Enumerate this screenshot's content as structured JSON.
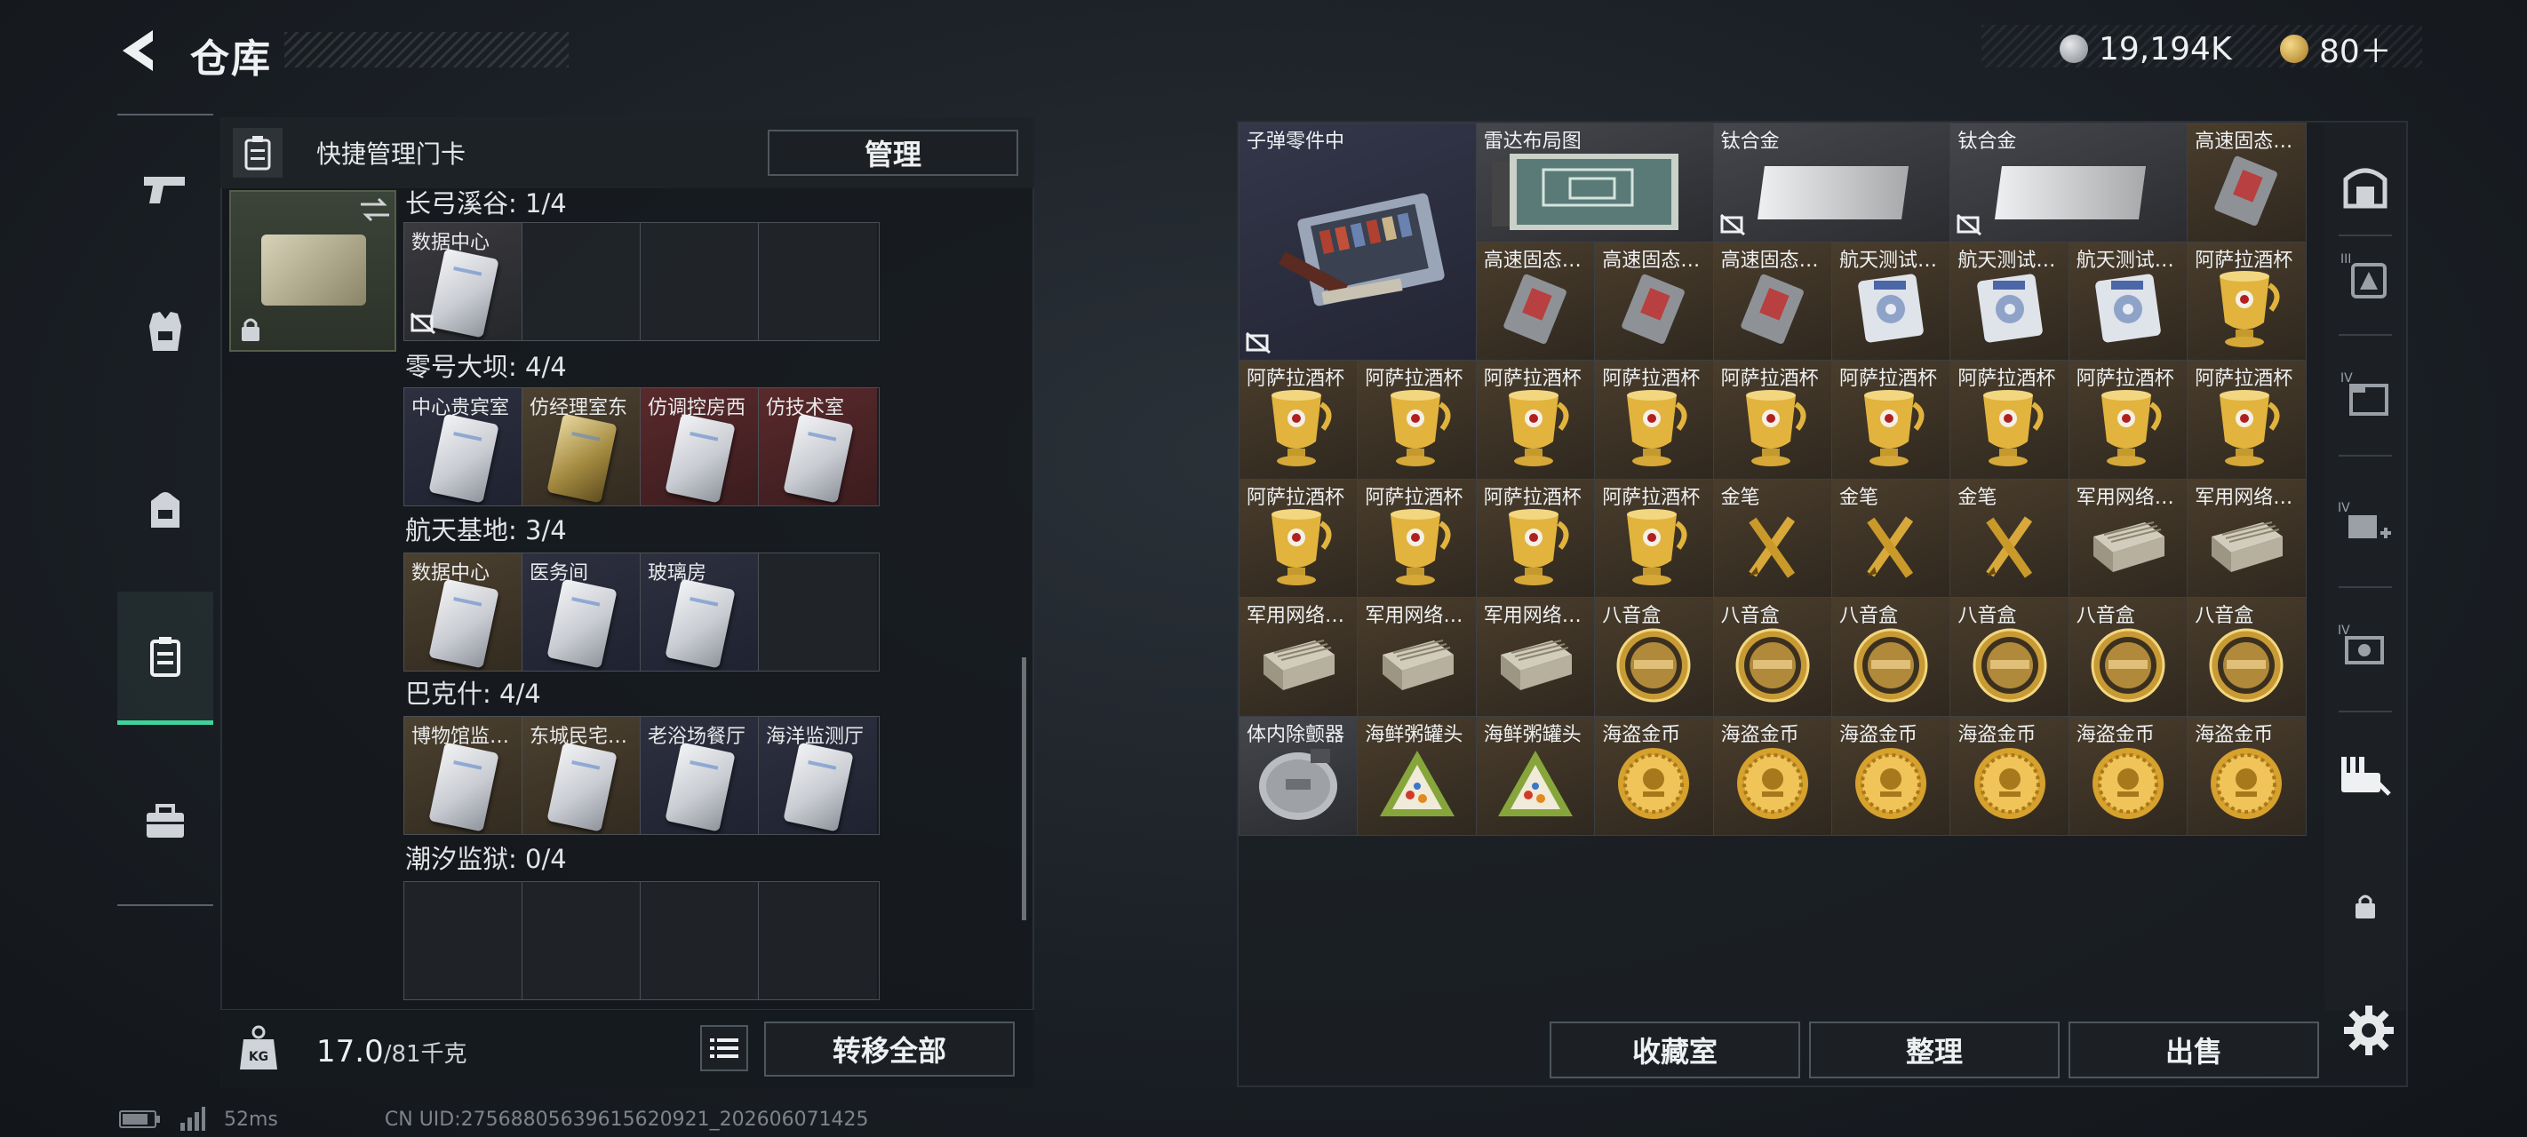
{
  "header": {
    "title": "仓库"
  },
  "currency": [
    {
      "name": "silver-coin",
      "value": "19,194K",
      "color": "#b8bcc2"
    },
    {
      "name": "gold-coin",
      "value": "80＋",
      "color": "#d9a83a"
    }
  ],
  "left_nav": [
    {
      "icon": "pistol-icon"
    },
    {
      "icon": "vest-icon"
    },
    {
      "icon": "backpack-icon"
    },
    {
      "icon": "keycard-holder-icon",
      "active": true
    },
    {
      "icon": "toolbox-icon"
    }
  ],
  "card_panel": {
    "quick_manage_label": "快捷管理门卡",
    "manage_button": "管理",
    "groups": [
      {
        "title": "长弓溪谷: 1/4",
        "slots": [
          {
            "label": "数据中心",
            "tone": "filled"
          },
          {},
          {},
          {}
        ]
      },
      {
        "title": "零号大坝: 4/4",
        "slots": [
          {
            "label": "中心贵宾室",
            "tone": "navy"
          },
          {
            "label": "仿经理室东",
            "tone": "brown",
            "gold": true
          },
          {
            "label": "仿调控房西",
            "tone": "red"
          },
          {
            "label": "仿技术室",
            "tone": "red"
          }
        ]
      },
      {
        "title": "航天基地: 3/4",
        "slots": [
          {
            "label": "数据中心",
            "tone": "brown"
          },
          {
            "label": "医务间",
            "tone": "navy"
          },
          {
            "label": "玻璃房",
            "tone": "navy"
          },
          {}
        ]
      },
      {
        "title": "巴克什: 4/4",
        "slots": [
          {
            "label": "博物馆监…",
            "tone": "brown"
          },
          {
            "label": "东城民宅…",
            "tone": "brown"
          },
          {
            "label": "老浴场餐厅",
            "tone": "navy"
          },
          {
            "label": "海洋监测厅",
            "tone": "navy"
          }
        ]
      },
      {
        "title": "潮汐监狱: 0/4",
        "slots": [
          {},
          {},
          {},
          {}
        ]
      }
    ],
    "weight_value": "17.0",
    "weight_capacity": "/81千克",
    "transfer_all_button": "转移全部"
  },
  "inventory": {
    "items": [
      {
        "label": "子弹零件中",
        "tone": "navy",
        "kind": "ammo-box",
        "col": 0,
        "row": 0,
        "w": 2,
        "h": 2
      },
      {
        "label": "雷达布局图",
        "tone": "grey",
        "kind": "map",
        "col": 2,
        "row": 0,
        "w": 2,
        "h": 1
      },
      {
        "label": "钛合金",
        "tone": "grey",
        "kind": "ingot",
        "col": 4,
        "row": 0,
        "w": 2,
        "h": 1
      },
      {
        "label": "钛合金",
        "tone": "grey",
        "kind": "ingot",
        "col": 6,
        "row": 0,
        "w": 2,
        "h": 1
      },
      {
        "label": "高速固态…",
        "tone": "brown",
        "kind": "ssd",
        "col": 8,
        "row": 0,
        "w": 1,
        "h": 1
      },
      {
        "label": "高速固态…",
        "tone": "brown",
        "kind": "ssd",
        "col": 2,
        "row": 1,
        "w": 1,
        "h": 1
      },
      {
        "label": "高速固态…",
        "tone": "brown",
        "kind": "ssd",
        "col": 3,
        "row": 1,
        "w": 1,
        "h": 1
      },
      {
        "label": "高速固态…",
        "tone": "brown",
        "kind": "ssd",
        "col": 4,
        "row": 1,
        "w": 1,
        "h": 1
      },
      {
        "label": "航天测试…",
        "tone": "brown",
        "kind": "disk",
        "col": 5,
        "row": 1,
        "w": 1,
        "h": 1
      },
      {
        "label": "航天测试…",
        "tone": "brown",
        "kind": "disk",
        "col": 6,
        "row": 1,
        "w": 1,
        "h": 1
      },
      {
        "label": "航天测试…",
        "tone": "brown",
        "kind": "disk",
        "col": 7,
        "row": 1,
        "w": 1,
        "h": 1
      },
      {
        "label": "阿萨拉酒杯",
        "tone": "brown",
        "kind": "cup",
        "col": 8,
        "row": 1,
        "w": 1,
        "h": 1
      },
      {
        "label": "阿萨拉酒杯",
        "tone": "brown",
        "kind": "cup",
        "col": 0,
        "row": 2,
        "w": 1,
        "h": 1
      },
      {
        "label": "阿萨拉酒杯",
        "tone": "brown",
        "kind": "cup",
        "col": 1,
        "row": 2,
        "w": 1,
        "h": 1
      },
      {
        "label": "阿萨拉酒杯",
        "tone": "brown",
        "kind": "cup",
        "col": 2,
        "row": 2,
        "w": 1,
        "h": 1
      },
      {
        "label": "阿萨拉酒杯",
        "tone": "brown",
        "kind": "cup",
        "col": 3,
        "row": 2,
        "w": 1,
        "h": 1
      },
      {
        "label": "阿萨拉酒杯",
        "tone": "brown",
        "kind": "cup",
        "col": 4,
        "row": 2,
        "w": 1,
        "h": 1
      },
      {
        "label": "阿萨拉酒杯",
        "tone": "brown",
        "kind": "cup",
        "col": 5,
        "row": 2,
        "w": 1,
        "h": 1
      },
      {
        "label": "阿萨拉酒杯",
        "tone": "brown",
        "kind": "cup",
        "col": 6,
        "row": 2,
        "w": 1,
        "h": 1
      },
      {
        "label": "阿萨拉酒杯",
        "tone": "brown",
        "kind": "cup",
        "col": 7,
        "row": 2,
        "w": 1,
        "h": 1
      },
      {
        "label": "阿萨拉酒杯",
        "tone": "brown",
        "kind": "cup",
        "col": 8,
        "row": 2,
        "w": 1,
        "h": 1
      },
      {
        "label": "阿萨拉酒杯",
        "tone": "brown",
        "kind": "cup",
        "col": 0,
        "row": 3,
        "w": 1,
        "h": 1
      },
      {
        "label": "阿萨拉酒杯",
        "tone": "brown",
        "kind": "cup",
        "col": 1,
        "row": 3,
        "w": 1,
        "h": 1
      },
      {
        "label": "阿萨拉酒杯",
        "tone": "brown",
        "kind": "cup",
        "col": 2,
        "row": 3,
        "w": 1,
        "h": 1
      },
      {
        "label": "阿萨拉酒杯",
        "tone": "brown",
        "kind": "cup",
        "col": 3,
        "row": 3,
        "w": 1,
        "h": 1
      },
      {
        "label": "金笔",
        "tone": "brown",
        "kind": "pen",
        "col": 4,
        "row": 3,
        "w": 1,
        "h": 1
      },
      {
        "label": "金笔",
        "tone": "brown",
        "kind": "pen",
        "col": 5,
        "row": 3,
        "w": 1,
        "h": 1
      },
      {
        "label": "金笔",
        "tone": "brown",
        "kind": "pen",
        "col": 6,
        "row": 3,
        "w": 1,
        "h": 1
      },
      {
        "label": "军用网络…",
        "tone": "brown",
        "kind": "router",
        "col": 7,
        "row": 3,
        "w": 1,
        "h": 1
      },
      {
        "label": "军用网络…",
        "tone": "brown",
        "kind": "router",
        "col": 8,
        "row": 3,
        "w": 1,
        "h": 1
      },
      {
        "label": "军用网络…",
        "tone": "brown",
        "kind": "router",
        "col": 0,
        "row": 4,
        "w": 1,
        "h": 1
      },
      {
        "label": "军用网络…",
        "tone": "brown",
        "kind": "router",
        "col": 1,
        "row": 4,
        "w": 1,
        "h": 1
      },
      {
        "label": "军用网络…",
        "tone": "brown",
        "kind": "router",
        "col": 2,
        "row": 4,
        "w": 1,
        "h": 1
      },
      {
        "label": "八音盒",
        "tone": "brown",
        "kind": "musicbox",
        "col": 3,
        "row": 4,
        "w": 1,
        "h": 1
      },
      {
        "label": "八音盒",
        "tone": "brown",
        "kind": "musicbox",
        "col": 4,
        "row": 4,
        "w": 1,
        "h": 1
      },
      {
        "label": "八音盒",
        "tone": "brown",
        "kind": "musicbox",
        "col": 5,
        "row": 4,
        "w": 1,
        "h": 1
      },
      {
        "label": "八音盒",
        "tone": "brown",
        "kind": "musicbox",
        "col": 6,
        "row": 4,
        "w": 1,
        "h": 1
      },
      {
        "label": "八音盒",
        "tone": "brown",
        "kind": "musicbox",
        "col": 7,
        "row": 4,
        "w": 1,
        "h": 1
      },
      {
        "label": "八音盒",
        "tone": "brown",
        "kind": "musicbox",
        "col": 8,
        "row": 4,
        "w": 1,
        "h": 1
      },
      {
        "label": "体内除颤器",
        "tone": "grey",
        "kind": "defib",
        "col": 0,
        "row": 5,
        "w": 1,
        "h": 1
      },
      {
        "label": "海鲜粥罐头",
        "tone": "brown",
        "kind": "can",
        "col": 1,
        "row": 5,
        "w": 1,
        "h": 1
      },
      {
        "label": "海鲜粥罐头",
        "tone": "brown",
        "kind": "can",
        "col": 2,
        "row": 5,
        "w": 1,
        "h": 1
      },
      {
        "label": "海盗金币",
        "tone": "brown",
        "kind": "coin",
        "col": 3,
        "row": 5,
        "w": 1,
        "h": 1
      },
      {
        "label": "海盗金币",
        "tone": "brown",
        "kind": "coin",
        "col": 4,
        "row": 5,
        "w": 1,
        "h": 1
      },
      {
        "label": "海盗金币",
        "tone": "brown",
        "kind": "coin",
        "col": 5,
        "row": 5,
        "w": 1,
        "h": 1
      },
      {
        "label": "海盗金币",
        "tone": "brown",
        "kind": "coin",
        "col": 6,
        "row": 5,
        "w": 1,
        "h": 1
      },
      {
        "label": "海盗金币",
        "tone": "brown",
        "kind": "coin",
        "col": 7,
        "row": 5,
        "w": 1,
        "h": 1
      },
      {
        "label": "海盗金币",
        "tone": "brown",
        "kind": "coin",
        "col": 8,
        "row": 5,
        "w": 1,
        "h": 1
      }
    ],
    "buttons": {
      "collection": "收藏室",
      "sort": "整理",
      "sell": "出售"
    }
  },
  "right_tabs": [
    {
      "icon": "safe-box-icon"
    },
    {
      "icon": "tier-iii-bag-icon"
    },
    {
      "icon": "tier-iv-folder-icon"
    },
    {
      "icon": "tier-iv-medkit-icon"
    },
    {
      "icon": "tier-iv-camera-icon"
    },
    {
      "icon": "tools-icon"
    },
    {
      "icon": "lock-icon"
    }
  ],
  "status_bar": {
    "ping": "52ms",
    "uid": "CN UID:2756880563961562092​1_202606071425"
  },
  "colors": {
    "accent": "#3fd29a",
    "panel": "#1c2024",
    "item_brown": "#4a3d2c"
  }
}
